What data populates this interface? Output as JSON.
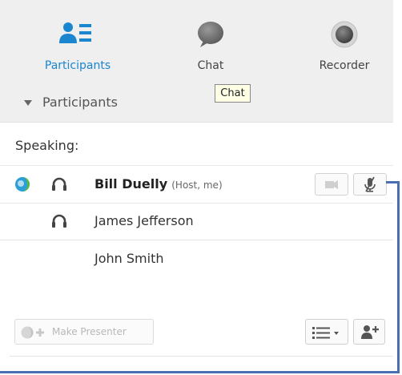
{
  "toolbar": {
    "participants_label": "Participants",
    "chat_label": "Chat",
    "recorder_label": "Recorder"
  },
  "tooltip": {
    "text": "Chat"
  },
  "section": {
    "title": "Participants"
  },
  "list": {
    "speaking_label": "Speaking:",
    "rows": [
      {
        "name": "Bill Duelly",
        "note": "(Host, me)",
        "icons": [
          "status-icon",
          "headset-icon"
        ],
        "video_button": "camera-icon",
        "mic_button": "mic-muted-icon"
      },
      {
        "name": "James Jefferson",
        "icons": [
          "headset-icon"
        ]
      },
      {
        "name": "John Smith",
        "icons": []
      }
    ]
  },
  "bottom": {
    "make_presenter_label": "Make Presenter",
    "list_menu_icon": "list-dropdown-icon",
    "add_participant_icon": "add-participant-icon"
  },
  "colors": {
    "accent": "#1a86d0",
    "toolbar_bg": "#efefef",
    "callout": "#4a6fb0"
  }
}
